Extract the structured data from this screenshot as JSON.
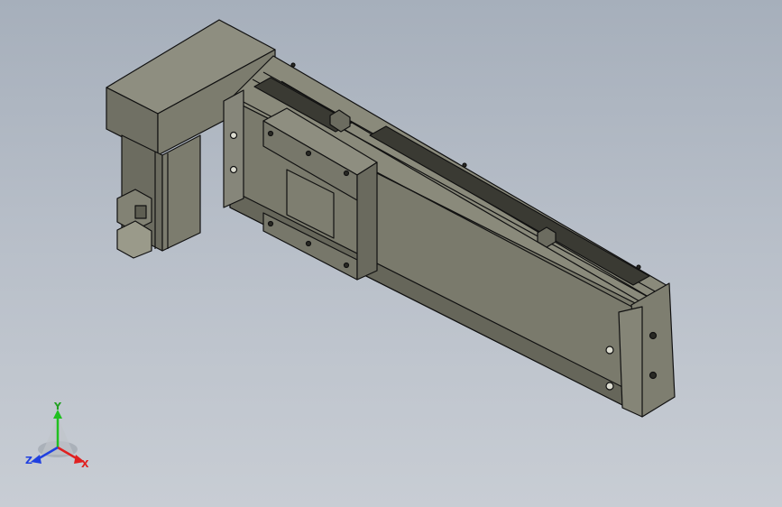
{
  "viewport": {
    "background_top": "#a6afbb",
    "background_bottom": "#c8cdd4"
  },
  "model": {
    "body_color": "#7a7a6c",
    "body_light": "#8b8b7c",
    "body_dark": "#5e5e52",
    "edge_color": "#111111"
  },
  "triad": {
    "x_label": "X",
    "y_label": "Y",
    "z_label": "Z",
    "x_color": "#e02020",
    "y_color": "#20c020",
    "z_color": "#2040e0"
  }
}
